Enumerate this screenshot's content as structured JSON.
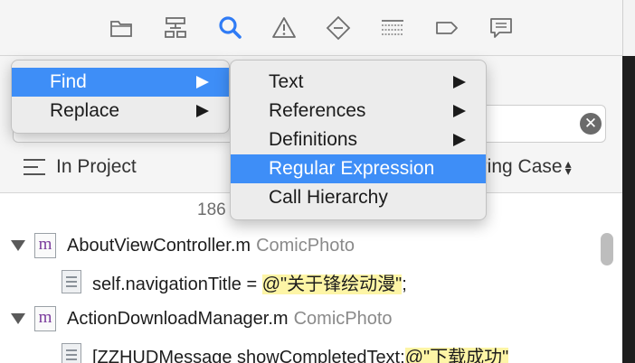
{
  "toolbar": {
    "icons": [
      "folder-icon",
      "hierarchy-icon",
      "search-icon",
      "warning-icon",
      "diamond-icon",
      "list-icon",
      "tag-icon",
      "comment-icon"
    ],
    "active_color": "#2f7bf5"
  },
  "search": {
    "value": "\" ' \" ' | ' ' ' ' '",
    "clear_label": "✕"
  },
  "scope": {
    "label": "In Project"
  },
  "matching": {
    "label": "oring Case"
  },
  "results": {
    "count": "186",
    "rows": [
      {
        "type": "file",
        "name": "AboutViewController.m",
        "project": "ComicPhoto",
        "icon_letter": "m"
      },
      {
        "type": "line",
        "before": "self.navigationTitle = ",
        "match": "@\"关于锋绘动漫\"",
        "after": ";"
      },
      {
        "type": "file",
        "name": "ActionDownloadManager.m",
        "project": "ComicPhoto",
        "icon_letter": "m"
      },
      {
        "type": "line",
        "before": "[ZZHUDMessage showCompletedText:",
        "match": "@\"下载成功\"",
        "after": ""
      }
    ]
  },
  "menu_primary": {
    "items": [
      {
        "label": "Find",
        "submenu": true,
        "active": true
      },
      {
        "label": "Replace",
        "submenu": true,
        "active": false
      }
    ]
  },
  "menu_secondary": {
    "items": [
      {
        "label": "Text",
        "submenu": true,
        "active": false
      },
      {
        "label": "References",
        "submenu": true,
        "active": false
      },
      {
        "label": "Definitions",
        "submenu": true,
        "active": false
      },
      {
        "label": "Regular Expression",
        "submenu": false,
        "active": true
      },
      {
        "label": "Call Hierarchy",
        "submenu": false,
        "active": false
      }
    ]
  },
  "colors": {
    "highlight": "#3e8ef7",
    "match_bg": "#fdf5a6"
  }
}
